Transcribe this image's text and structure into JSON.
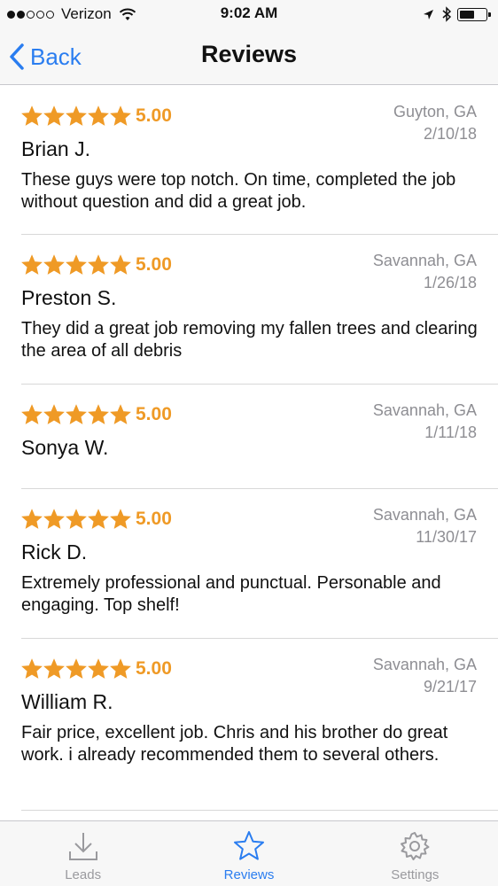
{
  "status_bar": {
    "carrier": "Verizon",
    "time": "9:02 AM",
    "signal_bars_filled": 2,
    "signal_bars_total": 5,
    "battery_level": 0.6
  },
  "nav": {
    "back_label": "Back",
    "title": "Reviews"
  },
  "reviews": [
    {
      "score": "5.00",
      "stars": 5,
      "location": "Guyton, GA",
      "date": "2/10/18",
      "name": "Brian J.",
      "text": "These guys were top notch. On time, completed the job without question and did a great job."
    },
    {
      "score": "5.00",
      "stars": 5,
      "location": "Savannah, GA",
      "date": "1/26/18",
      "name": "Preston S.",
      "text": "They did a great job removing my fallen trees and clearing the area of all debris"
    },
    {
      "score": "5.00",
      "stars": 5,
      "location": "Savannah, GA",
      "date": "1/11/18",
      "name": "Sonya W.",
      "text": ""
    },
    {
      "score": "5.00",
      "stars": 5,
      "location": "Savannah, GA",
      "date": "11/30/17",
      "name": "Rick D.",
      "text": "Extremely professional and punctual. Personable and engaging. Top shelf!"
    },
    {
      "score": "5.00",
      "stars": 5,
      "location": "Savannah, GA",
      "date": "9/21/17",
      "name": "William R.",
      "text": "Fair price, excellent job. Chris and his brother do great work. i already recommended them to several others."
    }
  ],
  "tabs": [
    {
      "label": "Leads",
      "icon": "download-icon",
      "active": false
    },
    {
      "label": "Reviews",
      "icon": "star-icon",
      "active": true
    },
    {
      "label": "Settings",
      "icon": "gear-icon",
      "active": false
    }
  ],
  "colors": {
    "accent": "#2a7df0",
    "star": "#ef9a26",
    "muted": "#8e8e93"
  }
}
